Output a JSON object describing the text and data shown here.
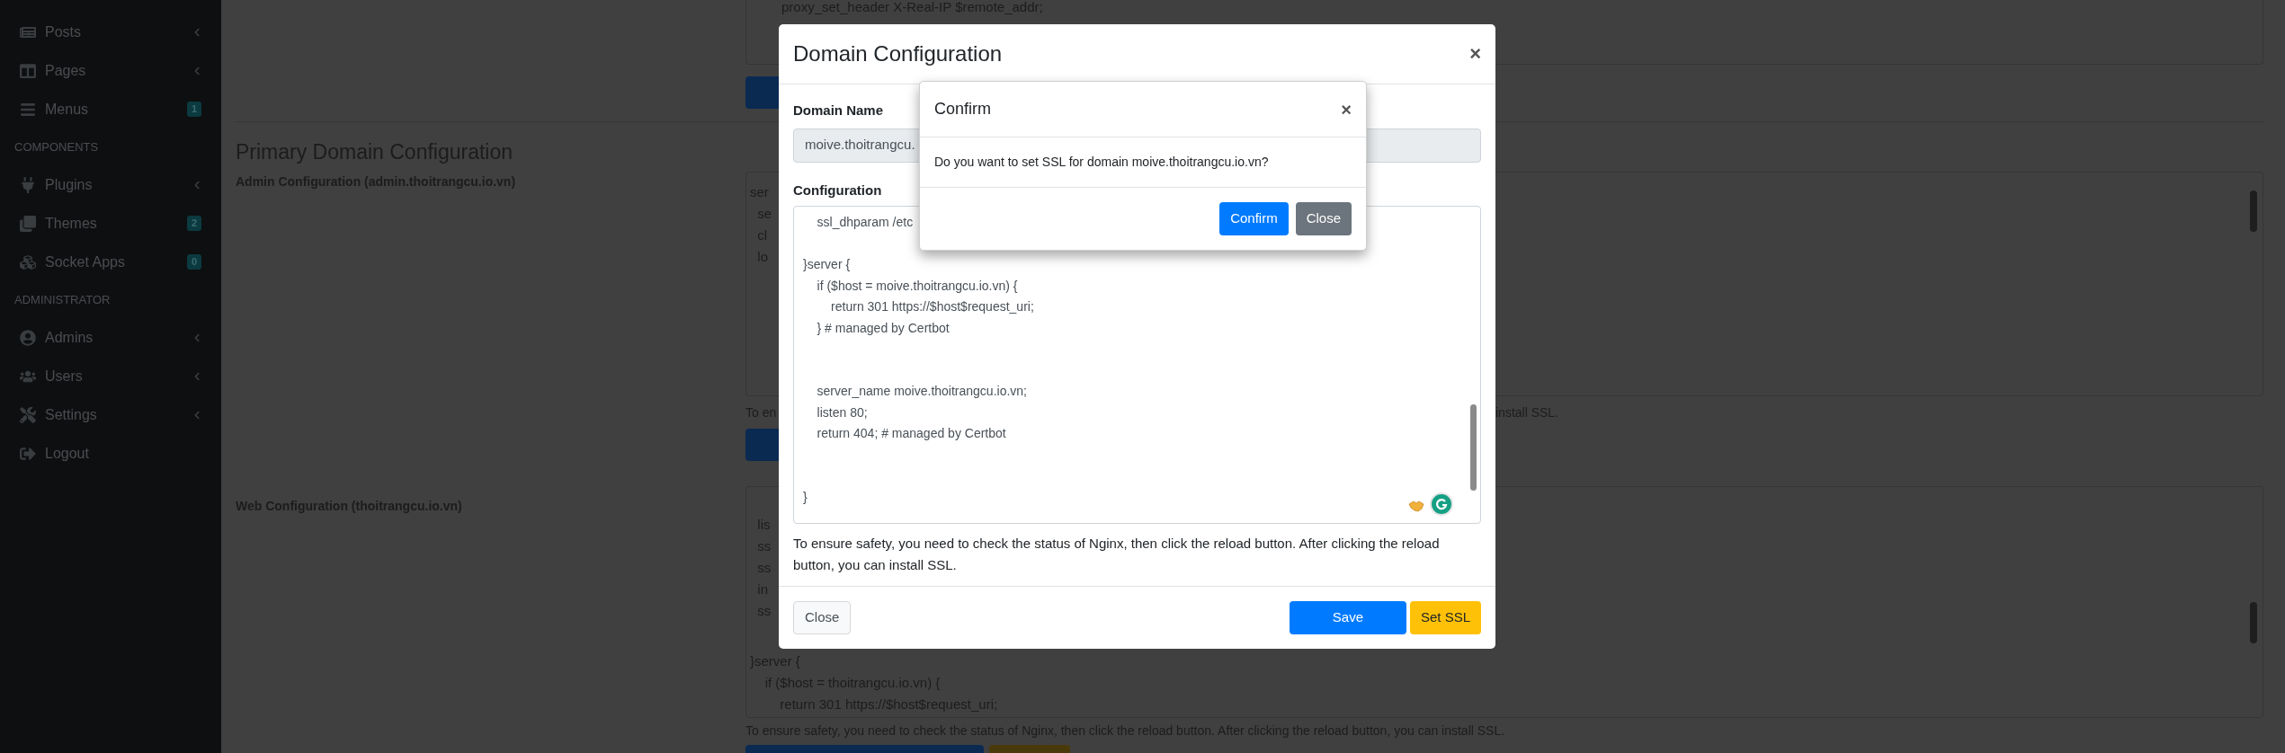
{
  "sidebar": {
    "items": [
      {
        "kind": "link",
        "label": "Posts",
        "expandable": true
      },
      {
        "kind": "link",
        "label": "Pages",
        "expandable": true
      },
      {
        "kind": "link",
        "label": "Menus",
        "expandable": false,
        "badge": "1"
      },
      {
        "kind": "header",
        "label": "COMPONENTS"
      },
      {
        "kind": "link",
        "label": "Plugins",
        "expandable": true
      },
      {
        "kind": "link",
        "label": "Themes",
        "expandable": false,
        "badge": "2"
      },
      {
        "kind": "link",
        "label": "Socket Apps",
        "expandable": false,
        "badge": "0"
      },
      {
        "kind": "header",
        "label": "ADMINISTRATOR"
      },
      {
        "kind": "link",
        "label": "Admins",
        "expandable": true
      },
      {
        "kind": "link",
        "label": "Users",
        "expandable": true
      },
      {
        "kind": "link",
        "label": "Settings",
        "expandable": true
      },
      {
        "kind": "link",
        "label": "Logout",
        "expandable": false
      }
    ]
  },
  "background": {
    "top_config_line": "proxy_set_header X-Real-IP $remote_addr;",
    "section_title": "Primary Domain Configuration",
    "admin": {
      "label": "Admin Configuration (admin.thoitrangcu.io.vn)",
      "config_fragments": [
        "ser",
        "  se",
        "  cl",
        "  lo"
      ],
      "note_start": "To en",
      "note_end": "install SSL."
    },
    "web": {
      "label": "Web Configuration (thoitrangcu.io.vn)",
      "config_fragments": [
        "  lis",
        "  ss",
        "  ss",
        "  in",
        "  ss"
      ],
      "config_lines_below": [
        "}server {",
        "    if ($host = thoitrangcu.io.vn) {",
        "        return 301 https://$host$request_uri;"
      ],
      "note": "To ensure safety, you need to check the status of Nginx, then click the reload button. After clicking the reload button, you can install SSL."
    }
  },
  "modal": {
    "title": "Domain Configuration",
    "close": "×",
    "domain_label": "Domain Name",
    "domain_value": "moive.thoitrangcu.",
    "config_label": "Configuration",
    "config_value": "    ssl_dhparam /etc\n\n}server {\n    if ($host = moive.thoitrangcu.io.vn) {\n        return 301 https://$host$request_uri;\n    } # managed by Certbot\n\n\n    server_name moive.thoitrangcu.io.vn;\n    listen 80;\n    return 404; # managed by Certbot\n\n\n}",
    "help": "To ensure safety, you need to check the status of Nginx, then click the reload button. After clicking the reload button, you can install SSL.",
    "buttons": [
      {
        "kind": "light",
        "label": "Close"
      },
      {
        "kind": "primary",
        "label": "Save"
      },
      {
        "kind": "warning",
        "label": "Set SSL"
      }
    ]
  },
  "confirm": {
    "title": "Confirm",
    "close": "×",
    "message": "Do you want to set SSL for domain moive.thoitrangcu.io.vn?",
    "buttons": [
      {
        "kind": "primary",
        "label": "Confirm"
      },
      {
        "kind": "secondary",
        "label": "Close"
      }
    ]
  }
}
